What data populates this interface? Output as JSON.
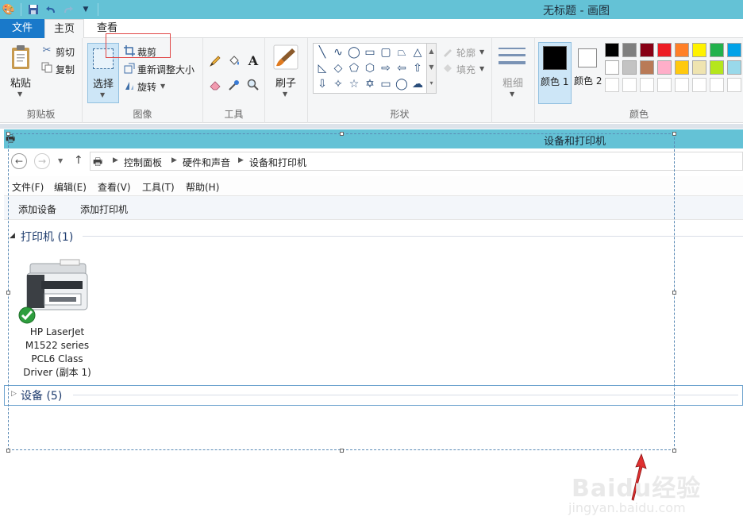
{
  "window": {
    "title": "无标题 - 画图"
  },
  "tabs": {
    "file": "文件",
    "home": "主页",
    "view": "查看"
  },
  "clipboard": {
    "paste": "粘贴",
    "cut": "剪切",
    "copy": "复制",
    "label": "剪贴板"
  },
  "image": {
    "select": "选择",
    "crop": "裁剪",
    "resize": "重新调整大小",
    "rotate": "旋转",
    "label": "图像"
  },
  "tools": {
    "text_glyph": "A",
    "label": "工具"
  },
  "brush": {
    "label": "刷子"
  },
  "shapes": {
    "outline": "轮廓",
    "fill": "填充",
    "label": "形状"
  },
  "size": {
    "label": "粗细"
  },
  "colors": {
    "color1": "颜色 1",
    "color2": "颜色 2",
    "label": "颜色",
    "color1_value": "#000000",
    "color2_value": "#ffffff",
    "palette_row1": [
      "#000000",
      "#7f7f7f",
      "#880015",
      "#ed1c24",
      "#ff7f27",
      "#fff200",
      "#22b14c",
      "#00a2e8"
    ],
    "palette_row2": [
      "#ffffff",
      "#c3c3c3",
      "#b97a57",
      "#ffaec9",
      "#ffc90e",
      "#efe4b0",
      "#b5e61d",
      "#99d9ea"
    ],
    "palette_row3": [
      "#ffffff",
      "#ffffff",
      "#ffffff",
      "#ffffff",
      "#ffffff",
      "#ffffff",
      "#ffffff",
      "#ffffff"
    ]
  },
  "explorer": {
    "title": "设备和打印机",
    "breadcrumbs": [
      "控制面板",
      "硬件和声音",
      "设备和打印机"
    ],
    "menu": [
      "文件(F)",
      "编辑(E)",
      "查看(V)",
      "工具(T)",
      "帮助(H)"
    ],
    "commands": [
      "添加设备",
      "添加打印机"
    ],
    "printers_section": "打印机 (1)",
    "printer_name_lines": [
      "HP LaserJet",
      "M1522 series",
      "PCL6 Class",
      "Driver (副本 1)"
    ],
    "devices_section": "设备 (5)"
  },
  "watermark": {
    "brand": "Baidu经验",
    "url": "jingyan.baidu.com"
  }
}
